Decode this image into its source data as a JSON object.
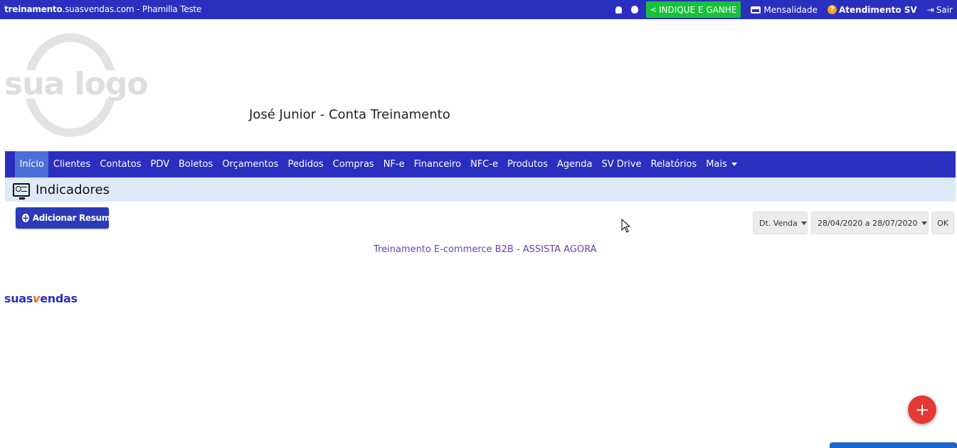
{
  "topbar": {
    "site_bold": "treinamento",
    "site_rest": ".suasvendas.com",
    "separator": " - ",
    "user": "Phamilla Teste",
    "indique": "INDIQUE E GANHE",
    "mensalidade": "Mensalidade",
    "atendimento": "Atendimento SV",
    "sair": "Sair"
  },
  "logo": {
    "text": "sua logo"
  },
  "account_title": "José Junior - Conta Treinamento",
  "nav": {
    "items": [
      "Início",
      "Clientes",
      "Contatos",
      "PDV",
      "Boletos",
      "Orçamentos",
      "Pedidos",
      "Compras",
      "NF-e",
      "Financeiro",
      "NFC-e",
      "Produtos",
      "Agenda",
      "SV Drive",
      "Relatórios",
      "Mais"
    ],
    "active": "Início"
  },
  "section": {
    "title": "Indicadores"
  },
  "actions": {
    "add_resumo": "Adicionar Resumo"
  },
  "filters": {
    "date_type": "Dt. Venda",
    "date_range": "28/04/2020 a 28/07/2020",
    "ok": "OK"
  },
  "training_link": "Treinamento E-commerce B2B - ASSISTA AGORA",
  "brand": {
    "part1": "suas",
    "part2": "v",
    "part3": "endas"
  },
  "fab": {
    "symbol": "+"
  },
  "colors": {
    "primary": "#2a2fbf",
    "active_nav": "#4a6fd6",
    "indique_green": "#17c23b",
    "indicator_bg": "#dfeaf9",
    "link_purple": "#6a3fb5",
    "fab_red": "#e53935",
    "brand_orange": "#ef6a1a"
  }
}
